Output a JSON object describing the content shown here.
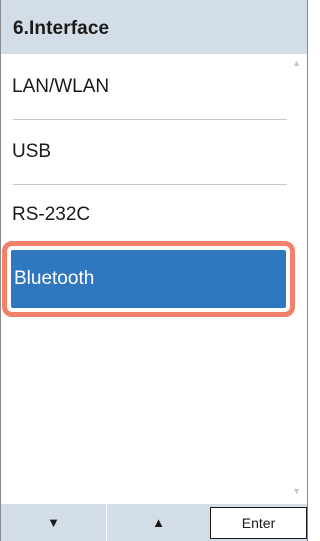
{
  "header": {
    "title": "6.Interface"
  },
  "menu": {
    "items": [
      {
        "label": "LAN/WLAN"
      },
      {
        "label": "USB"
      },
      {
        "label": "RS-232C"
      },
      {
        "label": "Bluetooth",
        "selected": true
      }
    ]
  },
  "scroll": {
    "up_icon": "▲",
    "down_icon": "▼"
  },
  "footer": {
    "down_glyph": "▼",
    "up_glyph": "▲",
    "enter_label": "Enter"
  },
  "colors": {
    "header_bg": "#d3dde7",
    "selection_fill": "#2f78bf",
    "selection_outline": "#f0826b",
    "divider": "#c8c8c8"
  }
}
